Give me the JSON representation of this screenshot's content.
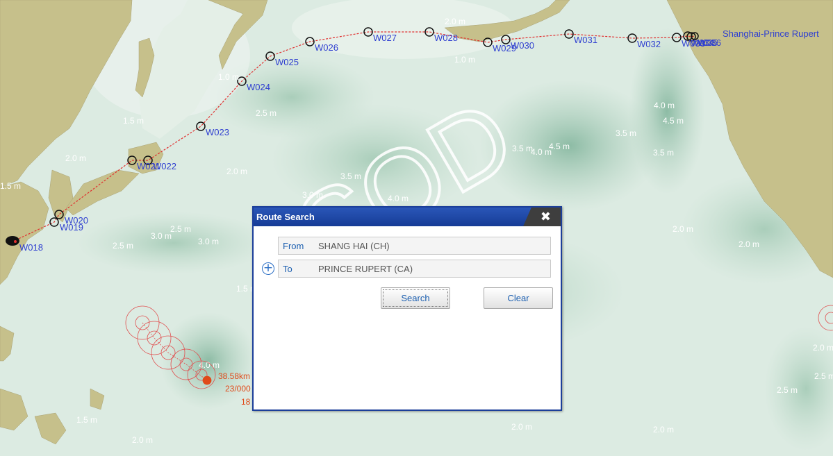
{
  "route_title": "Shanghai-Prince Rupert",
  "waypoints": [
    "W019",
    "W020",
    "W021",
    "W022",
    "W023",
    "W024",
    "W025",
    "W026",
    "W027",
    "W028",
    "W029",
    "W030",
    "W031",
    "W032",
    "W033",
    "W034",
    "W035",
    "W036"
  ],
  "start_label": "W018",
  "wave_heights": [
    "2.0 m",
    "1.0 m",
    "1.0 m",
    "2.5 m",
    "1.5 m",
    "2.0 m",
    "2.0 m",
    "1.5 m",
    "3.0 m",
    "3.5 m",
    "4.0 m",
    "4.5 m",
    "4.0 m",
    "3.5 m",
    "3.5 m",
    "3.5 m",
    "4.0 m",
    "4.5 m",
    "3.0 m",
    "2.5 m",
    "3.0 m",
    "2.5 m",
    "1.5 m",
    "2.0 m",
    "2.0 m",
    "2.0 m",
    "4.0 m",
    "1.5 m",
    "2.0 m",
    "2.0 m",
    "2.0 m",
    "2.5 m",
    "2.5 m"
  ],
  "storm": {
    "distance": "38.58km",
    "time": "23/000",
    "extra": "18"
  },
  "watermark": "SQD",
  "colors": {
    "route": "#e03030",
    "waypoint_label": "#2f3fd0",
    "dialog_border": "#1c3f9a",
    "land": "#c5bf8a",
    "sea": "#d9e9df",
    "storm": "#e04a1a"
  },
  "dialog": {
    "title": "Route Search",
    "close_icon": "close-icon",
    "from_label": "From",
    "from_value": "SHANG HAI (CH)",
    "to_label": "To",
    "to_value": "PRINCE RUPERT (CA)",
    "add_icon": "plus-circle-icon",
    "search_label": "Search",
    "clear_label": "Clear"
  }
}
